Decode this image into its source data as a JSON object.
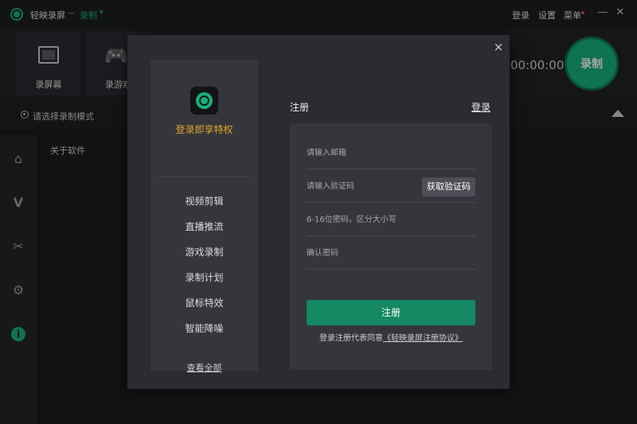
{
  "titlebar": {
    "app_title": "轻映录屏",
    "separator": "−",
    "mode": "录制",
    "login": "登录",
    "settings": "设置",
    "menu": "菜单"
  },
  "toolbar": {
    "tiles": [
      {
        "label": "录屏幕",
        "icon": "screen-icon"
      },
      {
        "label": "录游戏",
        "icon": "gamepad-icon"
      }
    ],
    "timer": "00:00:00",
    "record_label": "录制",
    "mode_hint": "请选择录制模式"
  },
  "nav": {
    "icons": [
      "home-icon",
      "vip-icon",
      "scissors-icon",
      "gear-icon",
      "info-icon"
    ],
    "content_title": "关于软件"
  },
  "colors": {
    "accent": "#18b07b",
    "perk_title": "#e3a52b",
    "submit": "#148963"
  },
  "modal": {
    "close": "×",
    "perks": {
      "title": "登录即享特权",
      "items": [
        "视频剪辑",
        "直播推流",
        "游戏录制",
        "录制计划",
        "鼠标特效",
        "智能降噪"
      ],
      "view_all": "查看全部"
    },
    "tabs": {
      "register": "注册",
      "login": "登录"
    },
    "form": {
      "email_placeholder": "请输入邮箱",
      "code_placeholder": "请输入验证码",
      "get_code": "获取验证码",
      "password_placeholder": "6-16位密码，区分大小写",
      "confirm_placeholder": "确认密码",
      "submit": "注册",
      "agree_prefix": "登录注册代表同意",
      "agree_link": "《轻映录屏注册协议》"
    }
  }
}
